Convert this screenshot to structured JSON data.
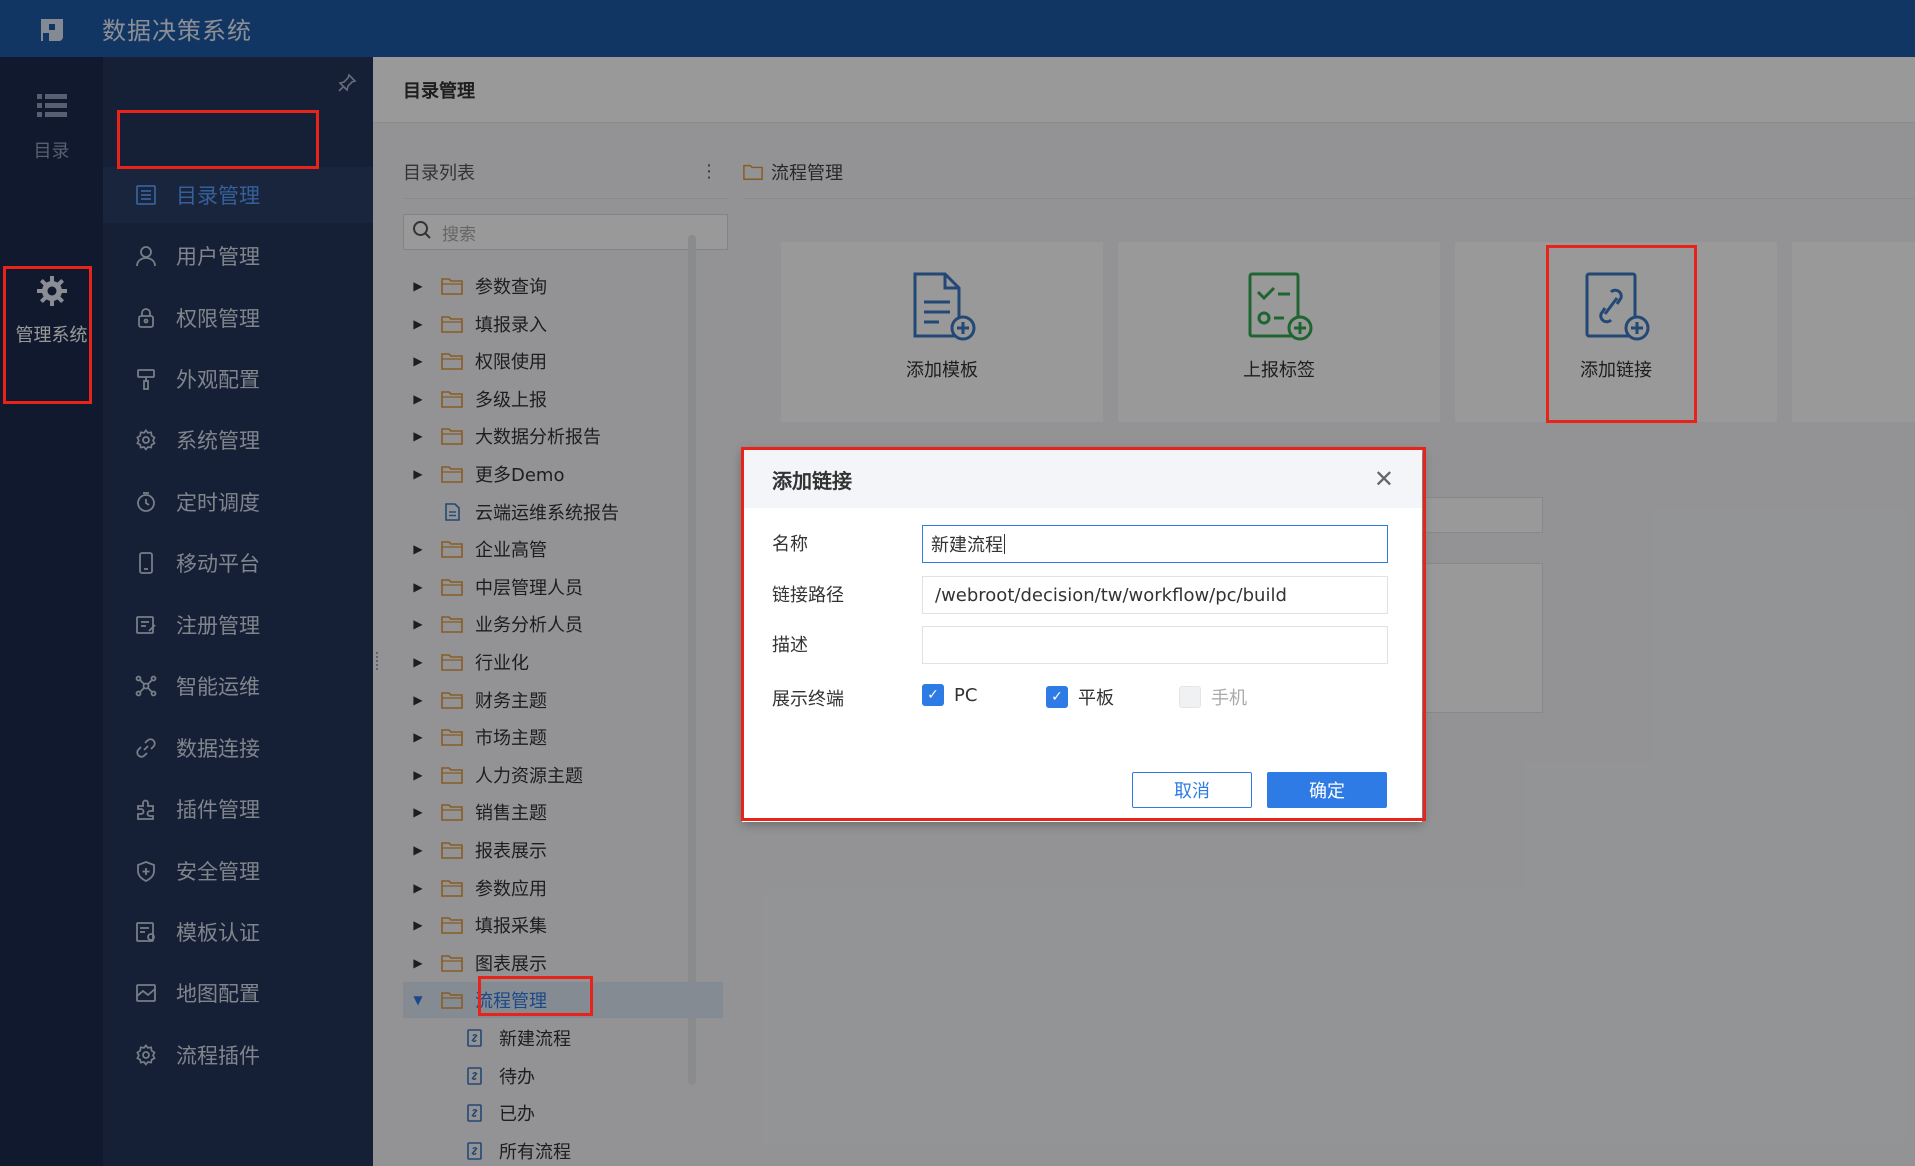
{
  "app": {
    "title": "数据决策系统"
  },
  "rail": [
    {
      "label": "目录",
      "icon": "list-icon",
      "active": false
    },
    {
      "label": "管理系统",
      "icon": "gear-icon",
      "active": true
    }
  ],
  "menu": [
    {
      "label": "目录管理",
      "icon": "directory-icon",
      "active": true
    },
    {
      "label": "用户管理",
      "icon": "user-icon"
    },
    {
      "label": "权限管理",
      "icon": "lock-icon"
    },
    {
      "label": "外观配置",
      "icon": "paint-icon"
    },
    {
      "label": "系统管理",
      "icon": "settings-icon"
    },
    {
      "label": "定时调度",
      "icon": "timer-icon"
    },
    {
      "label": "移动平台",
      "icon": "mobile-icon"
    },
    {
      "label": "注册管理",
      "icon": "register-icon"
    },
    {
      "label": "智能运维",
      "icon": "network-icon"
    },
    {
      "label": "数据连接",
      "icon": "link-icon"
    },
    {
      "label": "插件管理",
      "icon": "plugin-icon"
    },
    {
      "label": "安全管理",
      "icon": "shield-icon"
    },
    {
      "label": "模板认证",
      "icon": "certificate-icon"
    },
    {
      "label": "地图配置",
      "icon": "map-icon"
    },
    {
      "label": "流程插件",
      "icon": "workflow-icon"
    }
  ],
  "content": {
    "header": "目录管理",
    "tree_header": "目录列表",
    "search_placeholder": "搜索",
    "tree": [
      {
        "label": "参数查询",
        "type": "folder"
      },
      {
        "label": "填报录入",
        "type": "folder"
      },
      {
        "label": "权限使用",
        "type": "folder"
      },
      {
        "label": "多级上报",
        "type": "folder"
      },
      {
        "label": "大数据分析报告",
        "type": "folder"
      },
      {
        "label": "更多Demo",
        "type": "folder"
      },
      {
        "label": "云端运维系统报告",
        "type": "file"
      },
      {
        "label": "企业高管",
        "type": "folder"
      },
      {
        "label": "中层管理人员",
        "type": "folder"
      },
      {
        "label": "业务分析人员",
        "type": "folder"
      },
      {
        "label": "行业化",
        "type": "folder"
      },
      {
        "label": "财务主题",
        "type": "folder"
      },
      {
        "label": "市场主题",
        "type": "folder"
      },
      {
        "label": "人力资源主题",
        "type": "folder"
      },
      {
        "label": "销售主题",
        "type": "folder"
      },
      {
        "label": "报表展示",
        "type": "folder"
      },
      {
        "label": "参数应用",
        "type": "folder"
      },
      {
        "label": "填报采集",
        "type": "folder"
      },
      {
        "label": "图表展示",
        "type": "folder"
      },
      {
        "label": "流程管理",
        "type": "folder-open",
        "selected": true
      },
      {
        "label": "新建流程",
        "type": "link",
        "child": true
      },
      {
        "label": "待办",
        "type": "link",
        "child": true
      },
      {
        "label": "已办",
        "type": "link",
        "child": true
      },
      {
        "label": "所有流程",
        "type": "link",
        "child": true
      }
    ],
    "breadcrumb": "流程管理",
    "cards": [
      {
        "label": "添加模板",
        "icon": "add-template-icon",
        "color": "#3b78c4"
      },
      {
        "label": "上报标签",
        "icon": "report-tag-icon",
        "color": "#34a853"
      },
      {
        "label": "添加链接",
        "icon": "add-link-icon",
        "color": "#3b78c4"
      }
    ]
  },
  "dialog": {
    "title": "添加链接",
    "fields": {
      "name_label": "名称",
      "name_value": "新建流程",
      "path_label": "链接路径",
      "path_value": "/webroot/decision/tw/workflow/pc/build",
      "desc_label": "描述",
      "desc_value": "",
      "terminal_label": "展示终端"
    },
    "terminals": [
      {
        "label": "PC",
        "checked": true
      },
      {
        "label": "平板",
        "checked": true
      },
      {
        "label": "手机",
        "checked": false,
        "disabled": true
      }
    ],
    "cancel": "取消",
    "confirm": "确定"
  },
  "colors": {
    "topbar": "#1f5ba5",
    "accent": "#2f7be6",
    "annotation": "#e8231a"
  }
}
